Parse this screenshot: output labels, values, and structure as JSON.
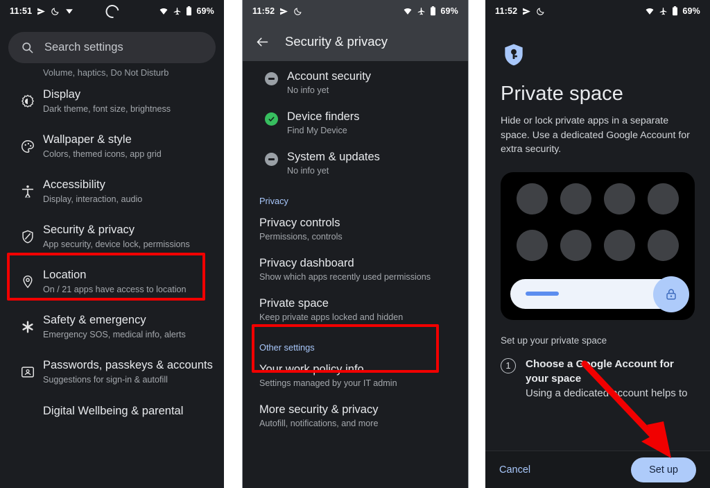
{
  "panels": {
    "settings_home": {
      "status": {
        "time": "11:51",
        "battery": "69%",
        "icons": [
          "location-icon",
          "dnd-moon-icon",
          "vpn-icon"
        ],
        "right_icons": [
          "wifi-icon",
          "airplane-mode-icon",
          "battery-icon"
        ],
        "center_icon": "loading-spinner-icon"
      },
      "search": {
        "placeholder": "Search settings",
        "icon": "search-icon"
      },
      "partial_row_top": "Volume, haptics, Do Not Disturb",
      "items": [
        {
          "icon": "display-brightness-icon",
          "title": "Display",
          "subtitle": "Dark theme, font size, brightness"
        },
        {
          "icon": "palette-icon",
          "title": "Wallpaper & style",
          "subtitle": "Colors, themed icons, app grid"
        },
        {
          "icon": "accessibility-icon",
          "title": "Accessibility",
          "subtitle": "Display, interaction, audio"
        },
        {
          "icon": "shield-icon",
          "title": "Security & privacy",
          "subtitle": "App security, device lock, permissions",
          "highlighted": true
        },
        {
          "icon": "location-pin-icon",
          "title": "Location",
          "subtitle": "On / 21 apps have access to location"
        },
        {
          "icon": "asterisk-icon",
          "title": "Safety & emergency",
          "subtitle": "Emergency SOS, medical info, alerts"
        },
        {
          "icon": "account-card-icon",
          "title": "Passwords, passkeys & accounts",
          "subtitle": "Suggestions for sign-in & autofill"
        }
      ],
      "partial_row_bottom": "Digital Wellbeing & parental"
    },
    "security_privacy": {
      "status": {
        "time": "11:52",
        "battery": "69%"
      },
      "appbar": {
        "back_icon": "back-arrow-icon",
        "title": "Security & privacy"
      },
      "items": [
        {
          "badge": "minus-badge",
          "title": "Account security",
          "subtitle": "No info yet"
        },
        {
          "badge": "check-badge",
          "title": "Device finders",
          "subtitle": "Find My Device"
        },
        {
          "badge": "minus-badge",
          "title": "System & updates",
          "subtitle": "No info yet"
        }
      ],
      "section_privacy": "Privacy",
      "privacy_items": [
        {
          "title": "Privacy controls",
          "subtitle": "Permissions, controls"
        },
        {
          "title": "Privacy dashboard",
          "subtitle": "Show which apps recently used permissions"
        },
        {
          "title": "Private space",
          "subtitle": "Keep private apps locked and hidden",
          "highlighted": true
        }
      ],
      "section_other": "Other settings",
      "other_items": [
        {
          "title": "Your work policy info",
          "subtitle": "Settings managed by your IT admin"
        },
        {
          "title": "More security & privacy",
          "subtitle": "Autofill, notifications, and more"
        }
      ]
    },
    "private_space": {
      "status": {
        "time": "11:52",
        "battery": "69%"
      },
      "hero_icon": "shield-key-icon",
      "title": "Private space",
      "description": "Hide or lock private apps in a separate space. Use a dedicated Google Account for extra security.",
      "illustration": {
        "name": "private-space-illustration",
        "dot_count": 8,
        "lock_icon": "lock-icon"
      },
      "setup_heading": "Set up your private space",
      "steps": [
        {
          "number": "1",
          "title": "Choose a Google Account for your space",
          "body": "Using a dedicated account helps to"
        }
      ],
      "cancel_label": "Cancel",
      "setup_label": "Set up"
    }
  },
  "annotations": {
    "highlight_color": "#f10000",
    "arrow_color": "#f10000",
    "arrow_name": "red-pointer-arrow",
    "arrow_target": "Set up"
  }
}
